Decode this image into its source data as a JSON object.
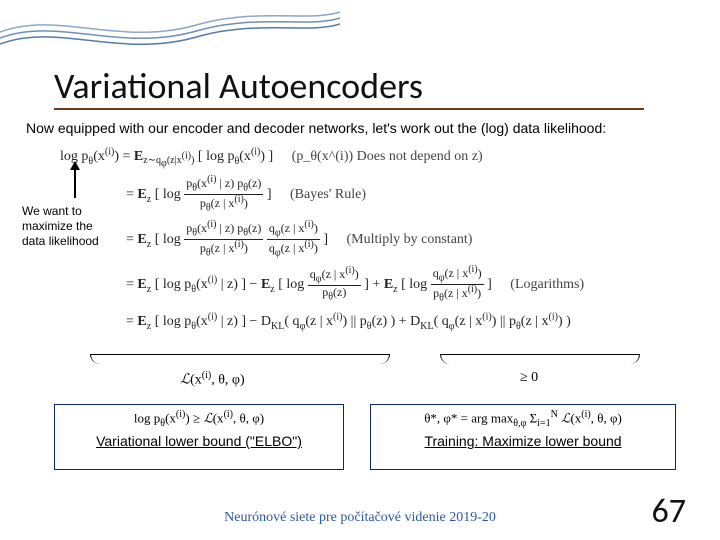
{
  "slide": {
    "title": "Variational Autoencoders",
    "intro": "Now equipped with our encoder and decoder networks, let's work out the (log) data likelihood:",
    "sidenote": "We want to maximize the data likelihood",
    "derivation": {
      "line1_math": "log p_θ(x^(i)) = E_{z∼q_φ(z|x^(i))} [ log p_θ(x^(i)) ]",
      "line1_annot": "(p_θ(x^(i)) Does not depend on z)",
      "line2_math": "= E_z [ log ( p_θ(x^(i) | z) p_θ(z) / p_θ(z | x^(i)) ) ]",
      "line2_annot": "(Bayes' Rule)",
      "line3_math": "= E_z [ log ( p_θ(x^(i) | z) p_θ(z) / p_θ(z | x^(i)) · q_φ(z | x^(i)) / q_φ(z | x^(i)) ) ]",
      "line3_annot": "(Multiply by constant)",
      "line4_math": "= E_z [ log p_θ(x^(i) | z) ] − E_z [ log ( q_φ(z | x^(i)) / p_θ(z) ) ] + E_z [ log ( q_φ(z | x^(i)) / p_θ(z | x^(i)) ) ]",
      "line4_annot": "(Logarithms)",
      "line5_math": "= E_z [ log p_θ(x^(i) | z) ] − D_KL( q_φ(z | x^(i)) || p_θ(z) ) + D_KL( q_φ(z | x^(i)) || p_θ(z | x^(i)) )"
    },
    "elbo_label": "ℒ(x^(i), θ, φ)",
    "geq0": "≥ 0",
    "box1_math": "log p_θ(x^(i)) ≥ ℒ(x^(i), θ, φ)",
    "box1_caption": "Variational lower bound (\"ELBO\")",
    "box2_math": "θ*, φ* = arg max_{θ,φ} Σ_{i=1}^{N} ℒ(x^(i), θ, φ)",
    "box2_caption": "Training: Maximize lower bound",
    "footer": "Neurónové siete pre počítačové videnie 2019-20",
    "page_number": "67"
  }
}
